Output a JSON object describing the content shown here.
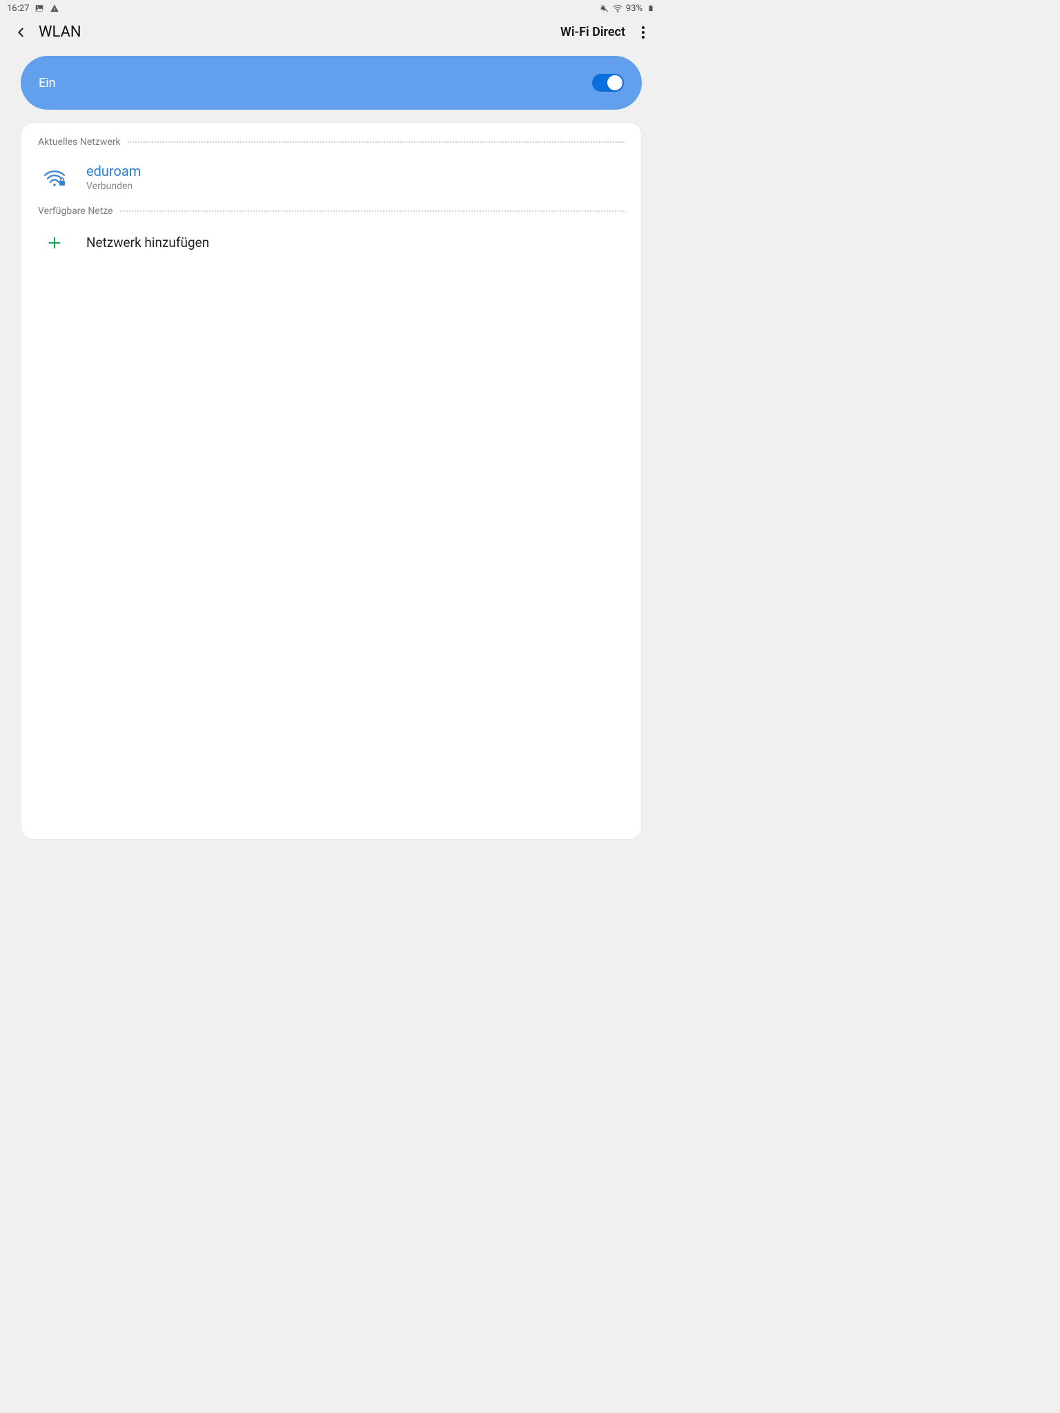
{
  "statusbar": {
    "time": "16:27",
    "battery": "93%"
  },
  "header": {
    "title": "WLAN",
    "action": "Wi-Fi Direct"
  },
  "toggle": {
    "label": "Ein",
    "on": true
  },
  "sections": {
    "current_label": "Aktuelles Netzwerk",
    "available_label": "Verfügbare Netze"
  },
  "current_network": {
    "name": "eduroam",
    "status": "Verbunden"
  },
  "add_network_label": "Netzwerk hinzufügen"
}
